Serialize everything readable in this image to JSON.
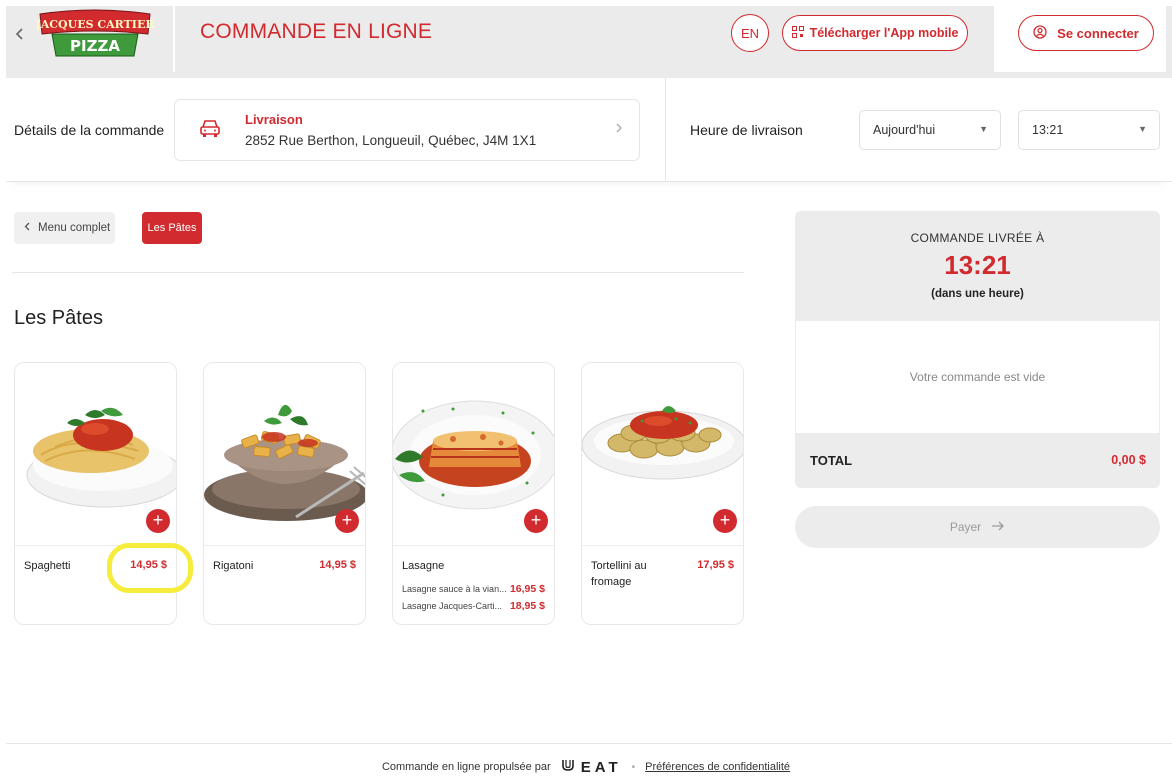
{
  "header": {
    "logo_text_top": "JACQUES CARTIER",
    "logo_text_bottom": "PIZZA",
    "title": "COMMANDE EN LIGNE",
    "lang": "EN",
    "app_button": "Télécharger l'App mobile",
    "login_button": "Se connecter"
  },
  "order_details": {
    "label": "Détails de la commande",
    "type": "Livraison",
    "address": "2852 Rue Berthon, Longueuil, Québec, J4M 1X1",
    "time_label": "Heure de livraison",
    "day": "Aujourd'hui",
    "time": "13:21"
  },
  "breadcrumb": {
    "back": "Menu complet",
    "current": "Les Pâtes"
  },
  "section_title": "Les Pâtes",
  "products": [
    {
      "name": "Spaghetti",
      "price": "14,95 $",
      "options": []
    },
    {
      "name": "Rigatoni",
      "price": "14,95 $",
      "options": []
    },
    {
      "name": "Lasagne",
      "price": "",
      "options": [
        {
          "label": "Lasagne sauce à la vian...",
          "price": "16,95 $"
        },
        {
          "label": "Lasagne Jacques-Carti...",
          "price": "18,95 $"
        }
      ]
    },
    {
      "name": "Tortellini au fromage",
      "price": "17,95 $",
      "options": []
    }
  ],
  "cart": {
    "delivered_label": "COMMANDE LIVRÉE À",
    "delivered_time": "13:21",
    "delivered_note": "(dans une heure)",
    "empty_text": "Votre commande est vide",
    "total_label": "TOTAL",
    "total_value": "0,00 $",
    "pay_button": "Payer"
  },
  "footer": {
    "powered_by": "Commande en ligne propulsée par",
    "brand": "EAT",
    "privacy": "Préférences de confidentialité"
  },
  "colors": {
    "accent": "#d12a2f",
    "highlight": "#f5ec3b"
  },
  "icons": [
    "chevron-left-icon",
    "qr-code-icon",
    "user-icon",
    "car-icon",
    "chevron-right-icon",
    "caret-down-icon",
    "plus-icon",
    "arrow-right-icon",
    "ueat-logo-icon"
  ]
}
